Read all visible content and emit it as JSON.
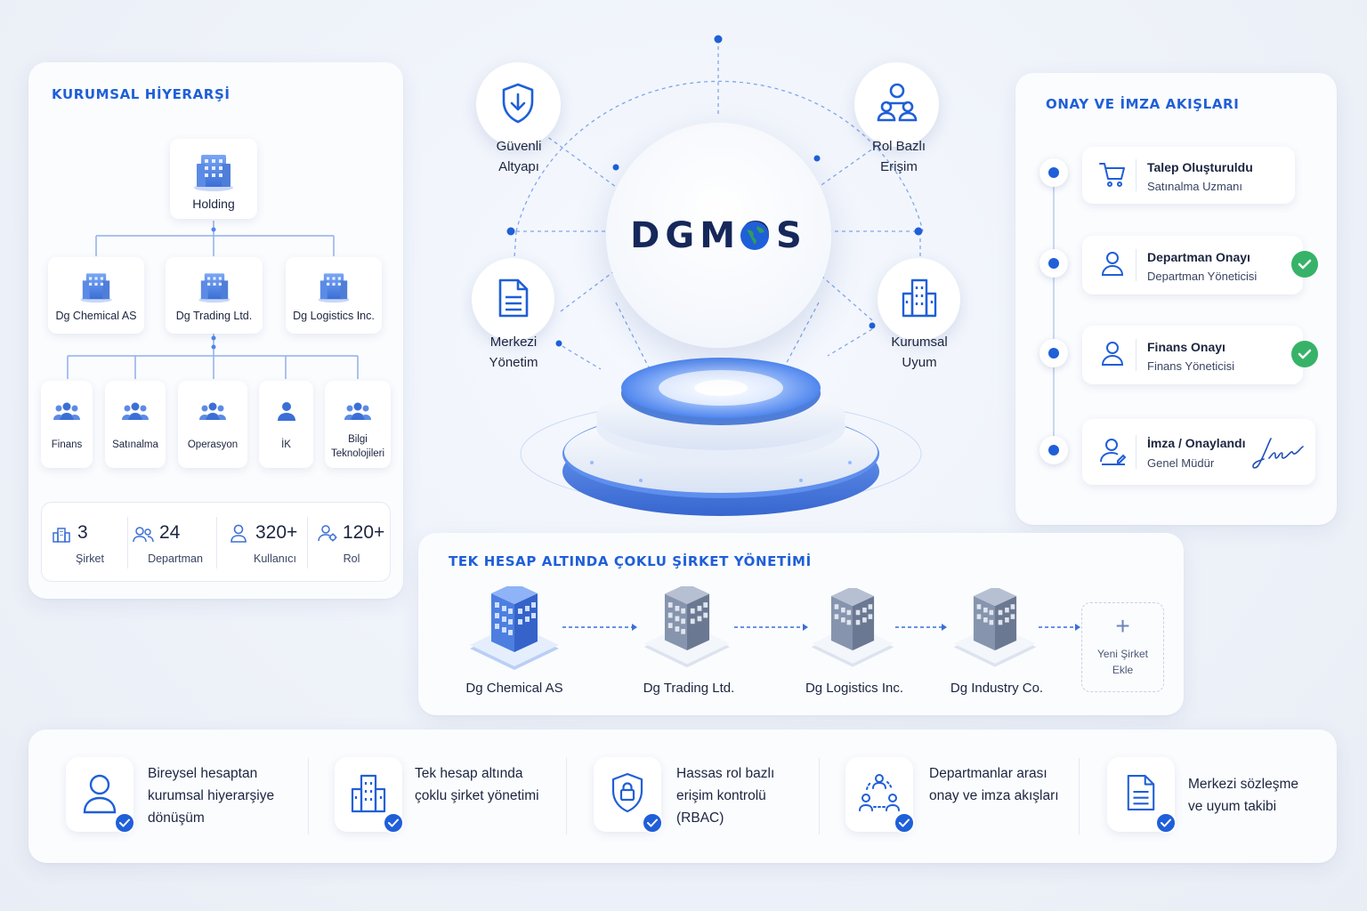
{
  "hierarchy": {
    "title": "KURUMSAL HİYERARŞİ",
    "root": "Holding",
    "companies": [
      "Dg Chemical AS",
      "Dg Trading Ltd.",
      "Dg Logistics Inc."
    ],
    "departments": [
      "Finans",
      "Satınalma",
      "Operasyon",
      "İK",
      "Bilgi Teknolojileri"
    ],
    "stats": [
      {
        "value": "3",
        "label": "Şirket",
        "icon": "building-icon"
      },
      {
        "value": "24",
        "label": "Departman",
        "icon": "users-icon"
      },
      {
        "value": "320+",
        "label": "Kullanıcı",
        "icon": "user-icon"
      },
      {
        "value": "120+",
        "label": "Rol",
        "icon": "role-icon"
      }
    ]
  },
  "hub": {
    "logo": "DGMOS",
    "nodes": {
      "secure": "Güvenli Altyapı",
      "rbac": "Rol Bazlı Erişim",
      "central": "Merkezi Yönetim",
      "compliance": "Kurumsal Uyum"
    }
  },
  "approval": {
    "title": "ONAY VE İMZA AKIŞLARI",
    "steps": [
      {
        "title": "Talep Oluşturuldu",
        "sub": "Satınalma Uzmanı",
        "icon": "cart-icon",
        "status": "none"
      },
      {
        "title": "Departman Onayı",
        "sub": "Departman Yöneticisi",
        "icon": "user-icon",
        "status": "approved"
      },
      {
        "title": "Finans Onayı",
        "sub": "Finans Yöneticisi",
        "icon": "user-icon",
        "status": "approved"
      },
      {
        "title": "İmza / Onaylandı",
        "sub": "Genel Müdür",
        "icon": "signer-icon",
        "status": "signed"
      }
    ]
  },
  "multi_company": {
    "title": "TEK HESAP ALTINDA ÇOKLU ŞİRKET YÖNETİMİ",
    "companies": [
      "Dg Chemical AS",
      "Dg Trading Ltd.",
      "Dg Logistics Inc.",
      "Dg Industry Co."
    ],
    "add_label": "Yeni Şirket Ekle"
  },
  "features": [
    {
      "text": "Bireysel hesaptan kurumsal hiyerarşiye dönüşüm",
      "icon": "user-icon"
    },
    {
      "text": "Tek hesap altında çoklu şirket yönetimi",
      "icon": "building-icon"
    },
    {
      "text": "Hassas rol bazlı erişim kontrolü (RBAC)",
      "icon": "shield-lock-icon"
    },
    {
      "text": "Departmanlar arası onay ve imza akışları",
      "icon": "team-flow-icon"
    },
    {
      "text": "Merkezi sözleşme ve uyum takibi",
      "icon": "document-icon"
    }
  ],
  "colors": {
    "accent": "#1f5fd8",
    "success": "#36b368",
    "text": "#1c2540"
  }
}
